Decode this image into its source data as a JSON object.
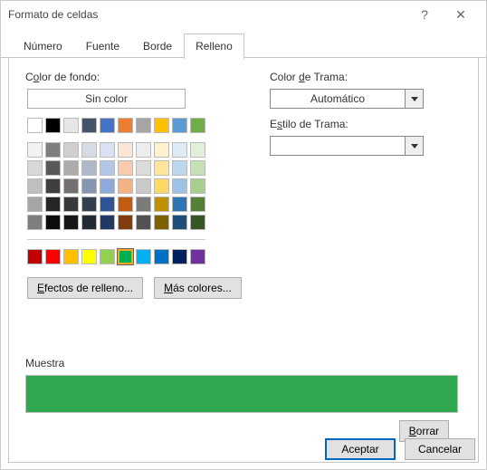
{
  "window": {
    "title": "Formato de celdas",
    "help": "?",
    "close": "✕"
  },
  "tabs": {
    "number": "Número",
    "font": "Fuente",
    "border": "Borde",
    "fill": "Relleno"
  },
  "fill": {
    "bg_label_pre": "C",
    "bg_label_ul": "o",
    "bg_label_post": "lor de fondo:",
    "no_color": "Sin color",
    "effects_pre": "",
    "effects_ul": "E",
    "effects_post": "fectos de relleno...",
    "more_pre": "",
    "more_ul": "M",
    "more_post": "ás colores...",
    "pattern_color_pre": "Color ",
    "pattern_color_ul": "d",
    "pattern_color_post": "e Trama:",
    "pattern_color_value": "Automático",
    "pattern_style_pre": "E",
    "pattern_style_ul": "s",
    "pattern_style_post": "tilo de Trama:",
    "pattern_style_value": ""
  },
  "colors": {
    "row1": [
      "#ffffff",
      "#000000",
      "#e7e6e6",
      "#44546a",
      "#4472c4",
      "#ed7d31",
      "#a5a5a5",
      "#ffc000",
      "#5b9bd5",
      "#70ad47"
    ],
    "theme": [
      [
        "#f2f2f2",
        "#7f7f7f",
        "#d0cece",
        "#d6dce4",
        "#d9e2f3",
        "#fbe5d5",
        "#ededed",
        "#fff2cc",
        "#deebf6",
        "#e2efd9"
      ],
      [
        "#d8d8d8",
        "#595959",
        "#aeabab",
        "#adb9ca",
        "#b4c6e7",
        "#f7cbac",
        "#dbdbdb",
        "#fee599",
        "#bdd7ee",
        "#c5e0b3"
      ],
      [
        "#bfbfbf",
        "#3f3f3f",
        "#757070",
        "#8496b0",
        "#8eaadb",
        "#f4b183",
        "#c9c9c9",
        "#ffd965",
        "#9cc3e5",
        "#a8d08d"
      ],
      [
        "#a5a5a5",
        "#262626",
        "#3a3838",
        "#323f4f",
        "#2f5496",
        "#c55a11",
        "#7b7b7b",
        "#bf9000",
        "#2e75b5",
        "#538135"
      ],
      [
        "#7f7f7f",
        "#0c0c0c",
        "#171616",
        "#222a35",
        "#1f3864",
        "#833c0b",
        "#525252",
        "#7f6000",
        "#1e4e79",
        "#375623"
      ]
    ],
    "standard": [
      "#c00000",
      "#ff0000",
      "#ffc000",
      "#ffff00",
      "#92d050",
      "#00b050",
      "#00b0f0",
      "#0070c0",
      "#002060",
      "#7030a0"
    ],
    "selected": "#00b050"
  },
  "sample": {
    "label": "Muestra",
    "color": "#2fa84f"
  },
  "buttons": {
    "clear_ul": "B",
    "clear_post": "orrar",
    "ok": "Aceptar",
    "cancel": "Cancelar"
  }
}
